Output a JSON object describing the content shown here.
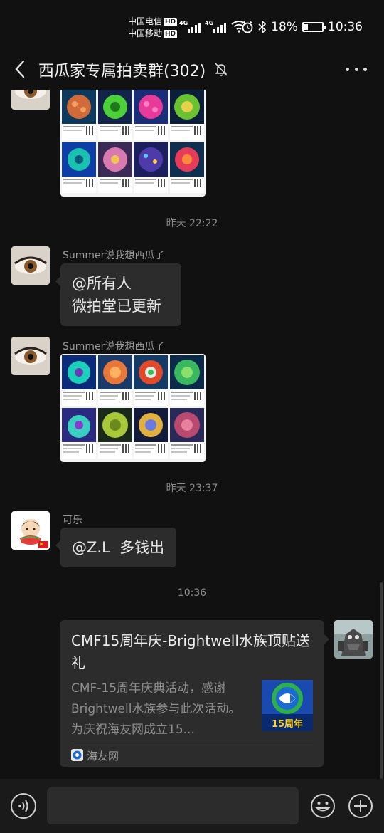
{
  "status_bar": {
    "carrier1": "中国电信",
    "carrier2": "中国移动",
    "hd_badge": "HD",
    "signal1_label": "4G",
    "signal2_label": "4G",
    "battery": "18%",
    "time": "10:36",
    "icons": [
      "hd-icon",
      "signal-icon",
      "wifi-icon",
      "alarm-icon",
      "bluetooth-icon",
      "battery-icon"
    ]
  },
  "header": {
    "title": "西瓜家专属拍卖群(302)",
    "icons": [
      "back-icon",
      "mute-icon",
      "more-icon"
    ]
  },
  "messages": {
    "ts1": "昨天 22:22",
    "msg2_sender": "Summer说我想西瓜了",
    "msg2_line1": "@所有人",
    "msg2_line2": "微拍堂已更新",
    "msg3_sender": "Summer说我想西瓜了",
    "ts2": "昨天 23:37",
    "msg4_sender": "可乐",
    "msg4_text": "@Z.L  多钱出",
    "ts3": "10:36"
  },
  "link_card": {
    "title": "CMF15周年庆-Brightwell水族顶贴送礼",
    "description": "CMF-15周年庆典活动，感谢Brightwell水族参与此次活动。为庆祝海友网成立15...",
    "thumb_text": "15周年",
    "source": "海友网"
  },
  "input_bar": {
    "placeholder": "",
    "icons": [
      "voice-icon",
      "emoji-icon",
      "plus-icon"
    ]
  },
  "colors": {
    "background": "#111111",
    "bubble": "#2c2c2c",
    "muted_text": "#8c8c8c"
  }
}
